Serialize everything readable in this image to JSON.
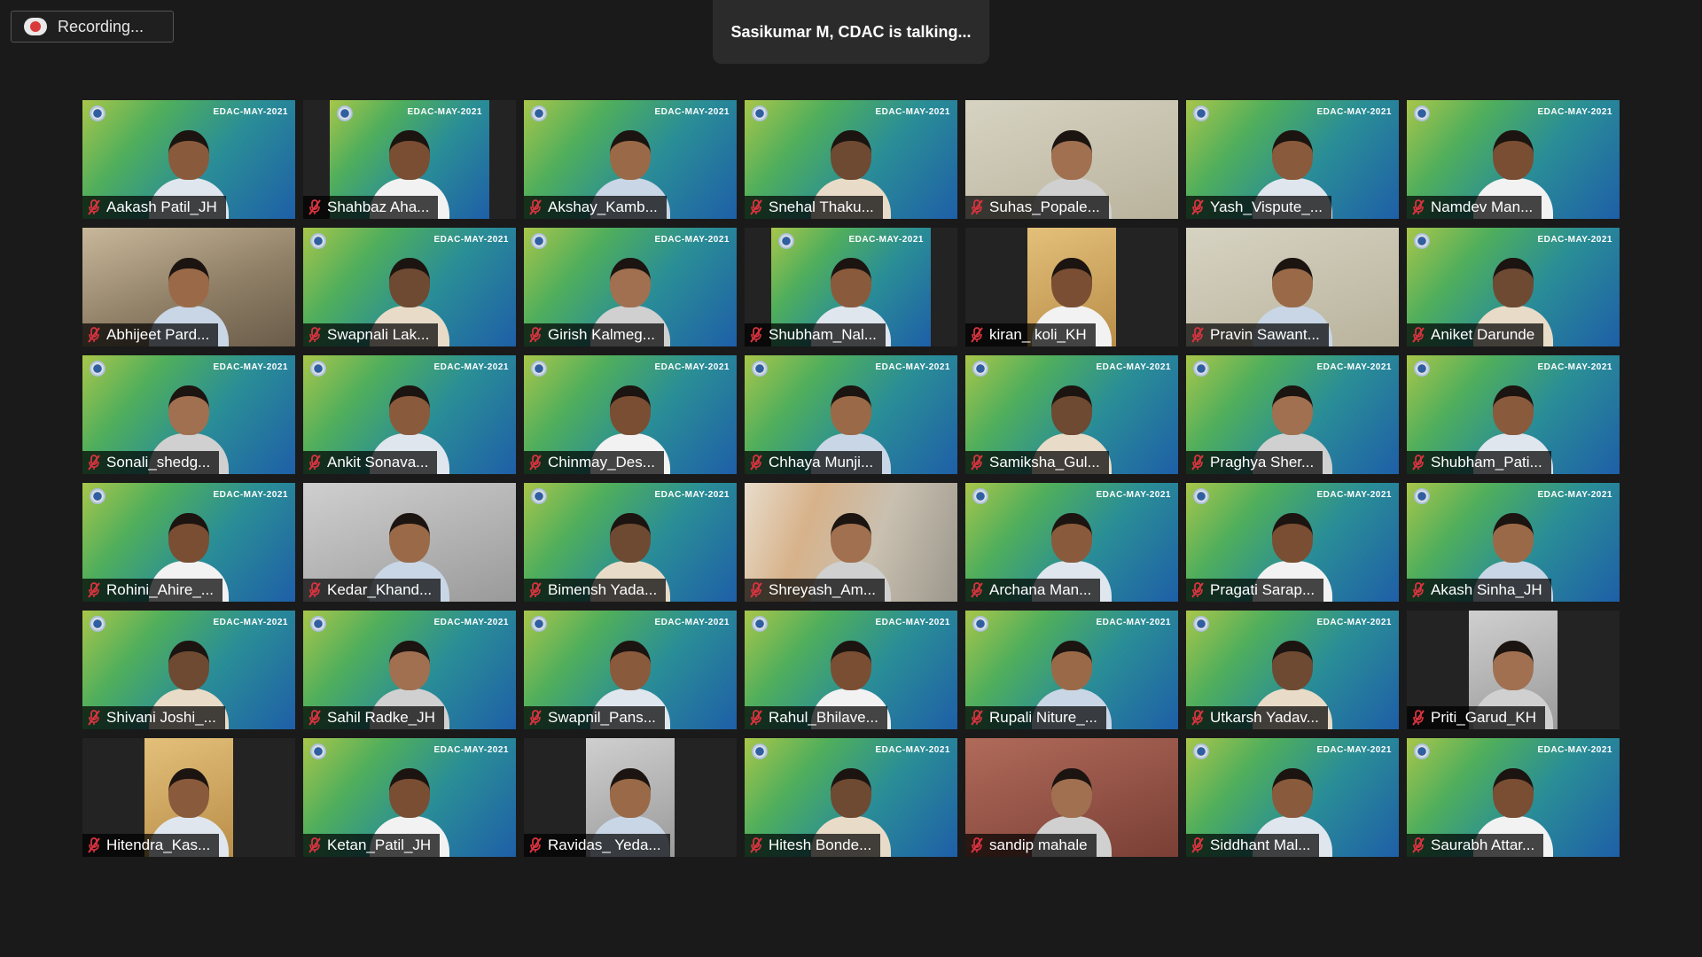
{
  "recording": {
    "label": "Recording..."
  },
  "talking": {
    "text": "Sasikumar M, CDAC is talking..."
  },
  "banner_text": "EDAC-MAY-2021",
  "colors": {
    "mute": "#d9333f",
    "background": "#1a1a1a"
  },
  "participants": [
    {
      "name": "Aakash Patil_JH",
      "muted": true
    },
    {
      "name": "Shahbaz Aha...",
      "muted": true
    },
    {
      "name": "Akshay_Kamb...",
      "muted": true
    },
    {
      "name": "Snehal Thaku...",
      "muted": true
    },
    {
      "name": "Suhas_Popale...",
      "muted": true
    },
    {
      "name": "Yash_Vispute_...",
      "muted": true
    },
    {
      "name": "Namdev Man...",
      "muted": true
    },
    {
      "name": "Abhijeet Pard...",
      "muted": true
    },
    {
      "name": "Swapnali Lak...",
      "muted": true
    },
    {
      "name": "Girish Kalmeg...",
      "muted": true
    },
    {
      "name": "Shubham_Nal...",
      "muted": true
    },
    {
      "name": "kiran_ koli_KH",
      "muted": true
    },
    {
      "name": "Pravin Sawant...",
      "muted": true
    },
    {
      "name": "Aniket Darunde",
      "muted": true
    },
    {
      "name": "Sonali_shedg...",
      "muted": true
    },
    {
      "name": "Ankit Sonava...",
      "muted": true
    },
    {
      "name": "Chinmay_Des...",
      "muted": true
    },
    {
      "name": "Chhaya Munji...",
      "muted": true
    },
    {
      "name": "Samiksha_Gul...",
      "muted": true
    },
    {
      "name": "Praghya Sher...",
      "muted": true
    },
    {
      "name": "Shubham_Pati...",
      "muted": true
    },
    {
      "name": "Rohini_Ahire_...",
      "muted": true
    },
    {
      "name": "Kedar_Khand...",
      "muted": true
    },
    {
      "name": "Bimensh Yada...",
      "muted": true
    },
    {
      "name": "Shreyash_Am...",
      "muted": true
    },
    {
      "name": "Archana Man...",
      "muted": true
    },
    {
      "name": "Pragati Sarap...",
      "muted": true
    },
    {
      "name": "Akash Sinha_JH",
      "muted": true
    },
    {
      "name": "Shivani Joshi_...",
      "muted": true
    },
    {
      "name": "Sahil Radke_JH",
      "muted": true
    },
    {
      "name": "Swapnil_Pans...",
      "muted": true
    },
    {
      "name": "Rahul_Bhilave...",
      "muted": true
    },
    {
      "name": "Rupali Niture_...",
      "muted": true
    },
    {
      "name": "Utkarsh Yadav...",
      "muted": true
    },
    {
      "name": "Priti_Garud_KH",
      "muted": true
    },
    {
      "name": "Hitendra_Kas...",
      "muted": true
    },
    {
      "name": "Ketan_Patil_JH",
      "muted": true
    },
    {
      "name": "Ravidas_ Yeda...",
      "muted": true
    },
    {
      "name": "Hitesh Bonde...",
      "muted": true
    },
    {
      "name": "sandip mahale",
      "muted": true
    },
    {
      "name": "Siddhant Mal...",
      "muted": true
    },
    {
      "name": "Saurabh Attar...",
      "muted": true
    }
  ]
}
